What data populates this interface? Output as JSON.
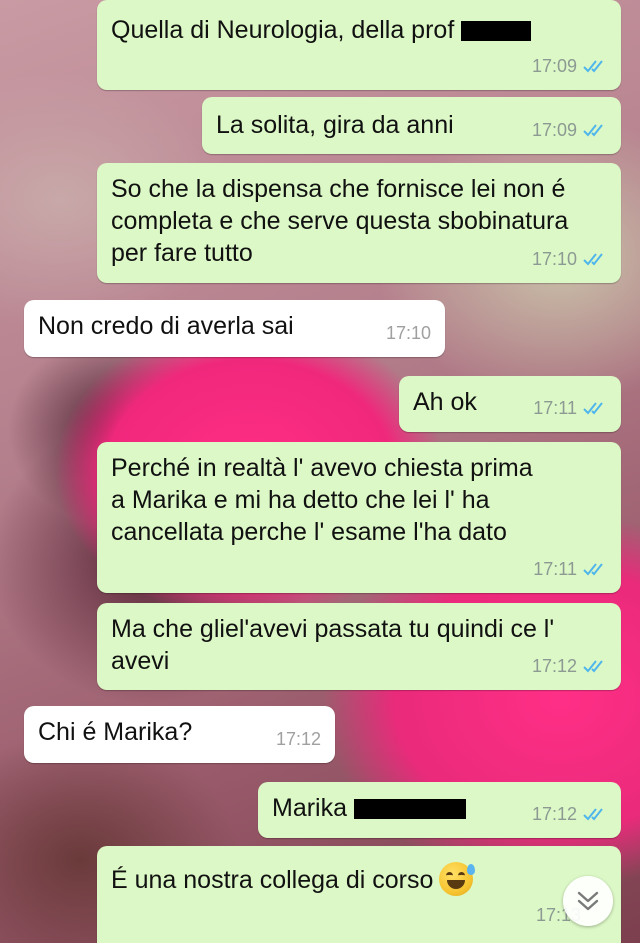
{
  "messages": [
    {
      "direction": "out",
      "text": "Quella di Neurologia, della prof ",
      "time": "17:09",
      "status": "read",
      "redacted": true
    },
    {
      "direction": "out",
      "text": "La solita, gira da anni",
      "time": "17:09",
      "status": "read"
    },
    {
      "direction": "out",
      "text": "So che la dispensa che fornisce lei non é\ncompleta e che serve questa sbobinatura\nper fare tutto",
      "time": "17:10",
      "status": "read"
    },
    {
      "direction": "in",
      "text": "Non credo di averla sai",
      "time": "17:10"
    },
    {
      "direction": "out",
      "text": "Ah ok",
      "time": "17:11",
      "status": "read"
    },
    {
      "direction": "out",
      "text": "Perché in realtà l' avevo chiesta prima\na Marika e mi ha detto che lei l' ha\ncancellata perche l' esame l'ha dato",
      "time": "17:11",
      "status": "read"
    },
    {
      "direction": "out",
      "text": "Ma che gliel'avevi passata tu quindi ce l'\navevi",
      "time": "17:12",
      "status": "read"
    },
    {
      "direction": "in",
      "text": "Chi é Marika?",
      "time": "17:12"
    },
    {
      "direction": "out",
      "text": "Marika ",
      "time": "17:12",
      "status": "read",
      "redacted": true
    },
    {
      "direction": "out",
      "text": "É una nostra collega di corso",
      "time": "17:13",
      "status": "read",
      "emoji": "grinning-face-with-sweat"
    }
  ],
  "colors": {
    "outgoing": "#dcf8c6",
    "incoming": "#ffffff",
    "read_ticks": "#4fb6ec"
  },
  "scroll_button": {
    "icon": "double-chevron-down-icon"
  }
}
